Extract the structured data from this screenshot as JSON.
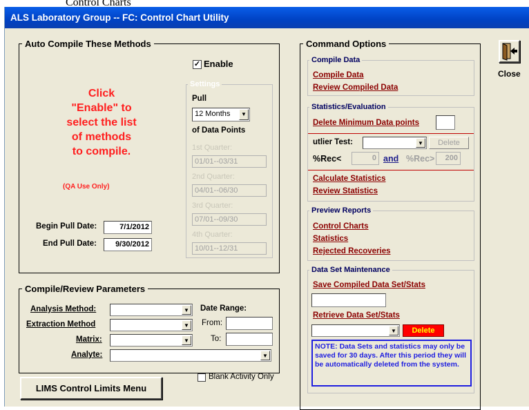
{
  "caption": "Control Charts",
  "window": {
    "title": "ALS Laboratory Group -- FC:  Control Chart Utility"
  },
  "auto_compile": {
    "legend": "Auto Compile These Methods",
    "enable_label": "Enable",
    "enable_checked": "☑",
    "message": "Click\n\"Enable\" to\nselect the list\nof methods\nto compile.",
    "qa_note": "(QA Use Only)",
    "begin_label": "Begin Pull Date:",
    "begin_value": "7/1/2012",
    "end_label": "End Pull Date:",
    "end_value": "9/30/2012",
    "settings": {
      "legend": "Settings",
      "pull_label": "Pull",
      "pull_value": "12 Months",
      "of_label": "of Data Points",
      "q1_label": "1st Quarter:",
      "q1_value": "01/01--03/31",
      "q2_label": "2nd Quarter:",
      "q2_value": "04/01--06/30",
      "q3_label": "3rd Quarter:",
      "q3_value": "07/01--09/30",
      "q4_label": "4th Quarter:",
      "q4_value": "10/01--12/31"
    }
  },
  "params": {
    "legend": "Compile/Review Parameters",
    "analysis_label": "Analysis Method:",
    "extraction_label": "Extraction Method",
    "matrix_label": "Matrix:",
    "analyte_label": "Analyte:",
    "date_range_label": "Date Range:",
    "from_label": "From:",
    "to_label": "To:",
    "blank_label": "Blank Activity Only",
    "lims_button": "LIMS Control Limits Menu"
  },
  "commands": {
    "legend": "Command Options",
    "compile": {
      "legend": "Compile Data",
      "compile_link": "Compile Data",
      "review_link": "Review Compiled Data"
    },
    "stats": {
      "legend": "Statistics/Evaluation",
      "delete_min_link": "Delete Minimum Data points",
      "outlier_label": "utlier Test:",
      "delete_button": "Delete",
      "rec_lt_label": "%Rec<",
      "rec_lt_value": "0",
      "and_label": "and",
      "rec_gt_label": "%Rec>",
      "rec_gt_value": "200",
      "calc_link": "Calculate Statistics",
      "review_link": "Review Statistics"
    },
    "preview": {
      "legend": "Preview Reports",
      "control_link": "Control Charts",
      "stats_link": "Statistics",
      "rejected_link": "Rejected Recoveries"
    },
    "dataset": {
      "legend": "Data Set Maintenance",
      "save_link": "Save Compiled Data Set/Stats",
      "retrieve_link": "Retrieve Data Set/Stats",
      "delete_button": "Delete",
      "note": "NOTE:  Data Sets and statistics may only be saved for 30 days.  After this period they will be automatically deleted from the system."
    }
  },
  "close": {
    "label": "Close",
    "icon": "exit-door-icon"
  },
  "colors": {
    "title_bar": "#0042c4",
    "window_bg": "#ece9d8",
    "link": "#8b0000",
    "alert": "#ff1e1e",
    "note": "#1e1ee0"
  }
}
